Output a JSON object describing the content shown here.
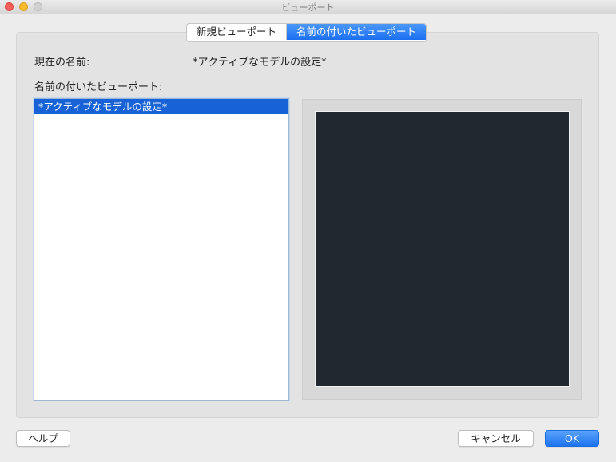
{
  "window": {
    "title": "ビューポート"
  },
  "tabs": [
    {
      "label": "新規ビューポート",
      "active": false
    },
    {
      "label": "名前の付いたビューポート",
      "active": true
    }
  ],
  "current_name": {
    "label": "現在の名前:",
    "value": "*アクティブなモデルの設定*"
  },
  "named_viewports": {
    "label": "名前の付いたビューポート:",
    "items": [
      {
        "label": "*アクティブなモデルの設定*",
        "selected": true
      }
    ]
  },
  "buttons": {
    "help": "ヘルプ",
    "cancel": "キャンセル",
    "ok": "OK"
  },
  "colors": {
    "accent": "#1662d6",
    "preview_background": "#212830"
  }
}
